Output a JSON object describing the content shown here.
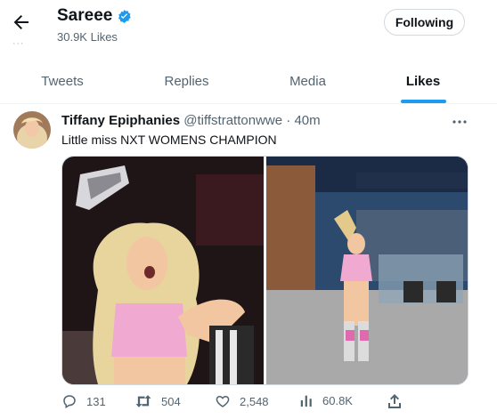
{
  "header": {
    "name": "Sareee",
    "likes_count": "30.9K Likes",
    "follow_button": "Following"
  },
  "tabs": [
    {
      "label": "Tweets"
    },
    {
      "label": "Replies"
    },
    {
      "label": "Media"
    },
    {
      "label": "Likes",
      "active": true
    }
  ],
  "tweet": {
    "author": "Tiffany Epiphanies",
    "handle": "@tiffstrattonwwe",
    "time": "40m",
    "text": "Little miss NXT WOMENS CHAMPION",
    "stats": {
      "replies": "131",
      "retweets": "504",
      "likes": "2,548",
      "views": "60.8K"
    }
  },
  "colors": {
    "accent": "#1d9bf0",
    "secondary_text": "#536471",
    "primary_text": "#0f1419"
  }
}
